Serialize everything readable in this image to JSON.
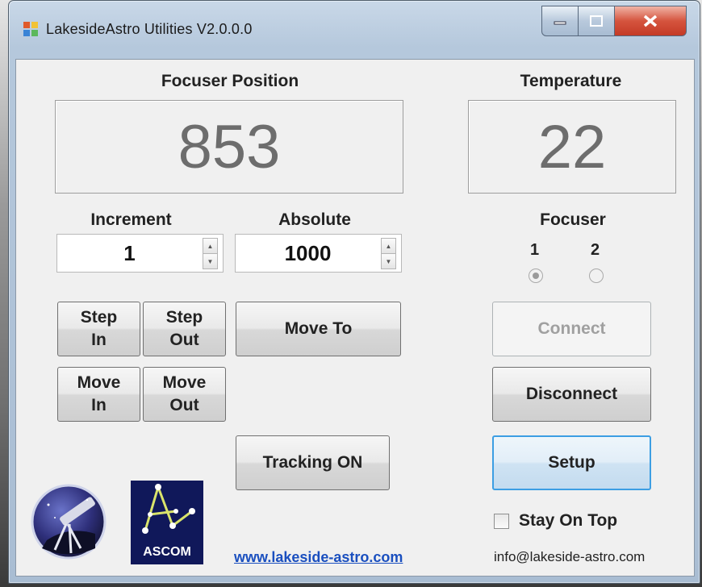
{
  "window": {
    "title": "LakesideAstro Utilities V2.0.0.0"
  },
  "position": {
    "label": "Focuser Position",
    "value": "853"
  },
  "temperature": {
    "label": "Temperature",
    "value": "22"
  },
  "increment": {
    "label": "Increment",
    "value": "1"
  },
  "absolute": {
    "label": "Absolute",
    "value": "1000"
  },
  "focuser": {
    "label": "Focuser",
    "option1": "1",
    "option2": "2",
    "selected": "1"
  },
  "buttons": {
    "step_in": "Step\nIn",
    "step_out": "Step\nOut",
    "move_in": "Move\nIn",
    "move_out": "Move\nOut",
    "move_to": "Move To",
    "tracking": "Tracking ON",
    "connect": "Connect",
    "disconnect": "Disconnect",
    "setup": "Setup"
  },
  "stay_on_top": {
    "label": "Stay On Top",
    "checked": false
  },
  "footer": {
    "website": "www.lakeside-astro.com",
    "email": "info@lakeside-astro.com"
  },
  "ascom_logo": {
    "text": "ASCOM"
  }
}
